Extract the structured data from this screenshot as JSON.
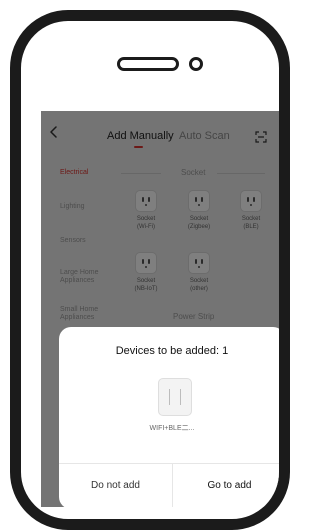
{
  "header": {
    "tab_manual": "Add Manually",
    "tab_auto": "Auto Scan"
  },
  "categories": [
    "Electrical",
    "Lighting",
    "Sensors",
    "Large Home Appliances",
    "Small Home Appliances"
  ],
  "sections": {
    "socket_title": "Socket",
    "strip_title": "Power Strip"
  },
  "devices": [
    {
      "name": "Socket\n(Wi-Fi)"
    },
    {
      "name": "Socket\n(Zigbee)"
    },
    {
      "name": "Socket\n(BLE)"
    },
    {
      "name": "Socket\n(NB-IoT)"
    },
    {
      "name": "Socket\n(other)"
    }
  ],
  "dialog": {
    "title": "Devices to be added: 1",
    "device_name": "WIFI+BLE二...",
    "cancel_label": "Do not add",
    "confirm_label": "Go to add"
  },
  "colors": {
    "accent": "#d9332e"
  }
}
